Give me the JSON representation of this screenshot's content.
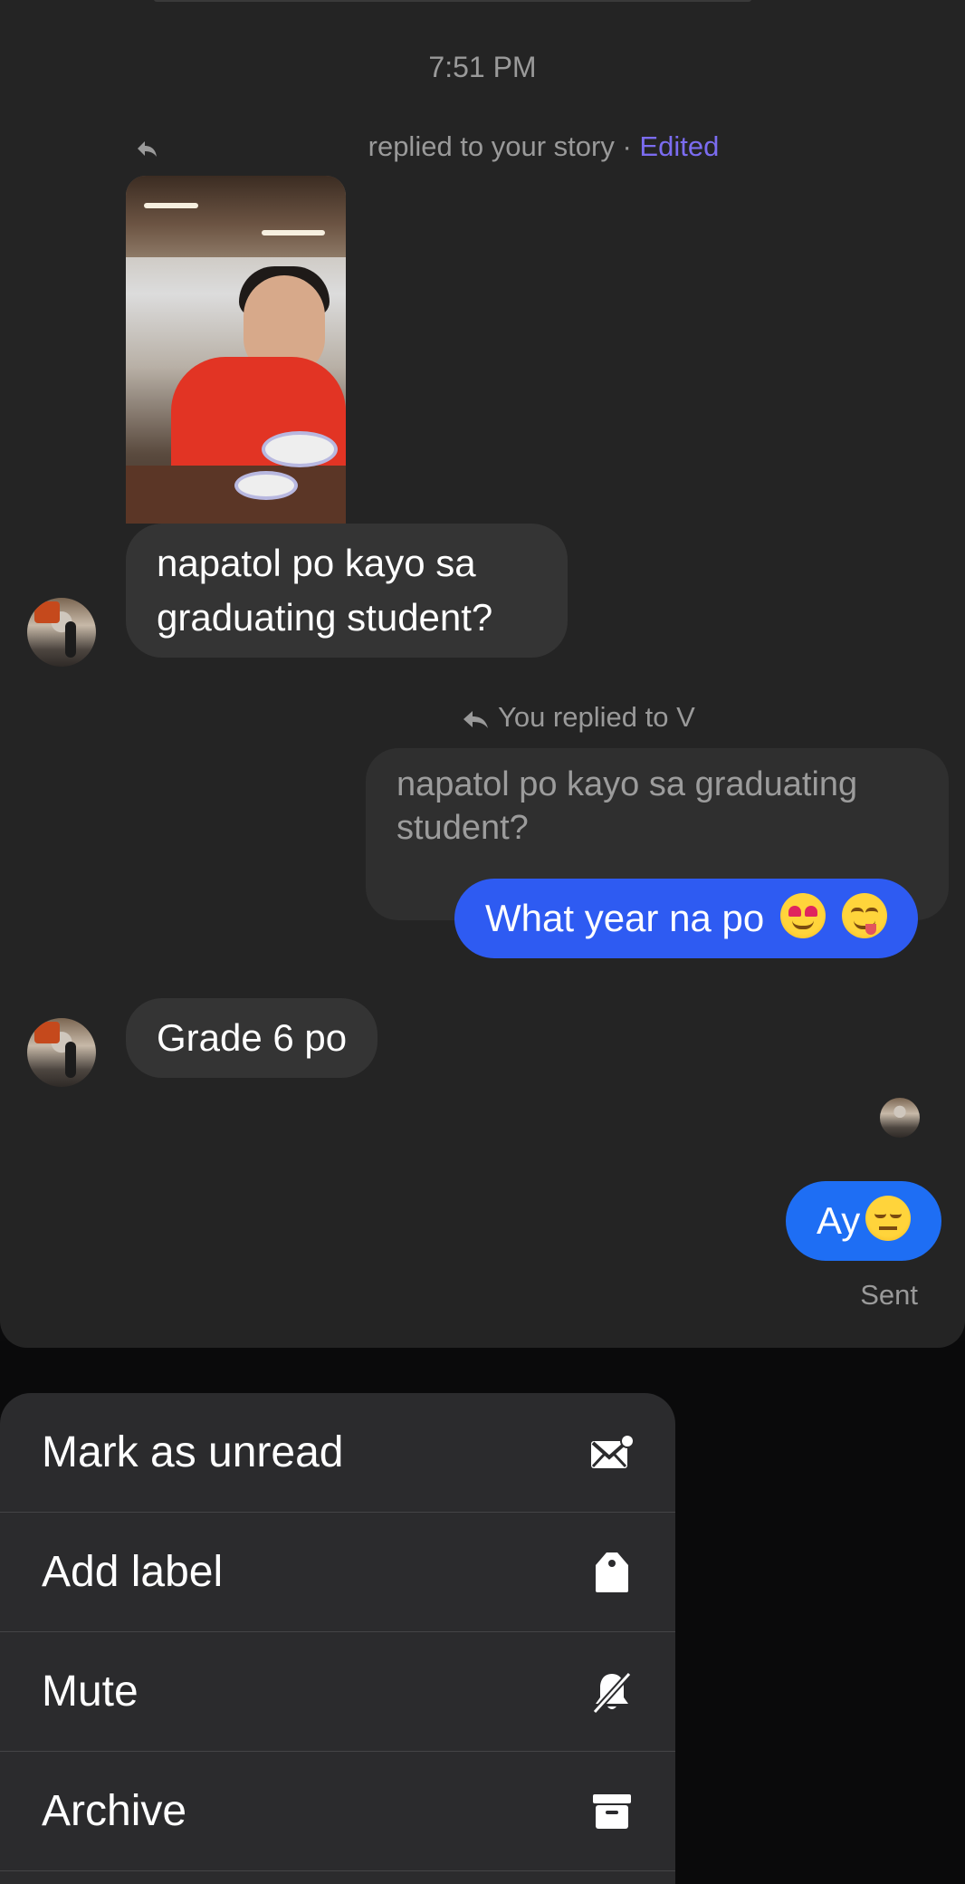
{
  "chat": {
    "timestamp": "7:51 PM",
    "story_reply_note": "replied to your story",
    "edited_label": "Edited",
    "messages": [
      {
        "text": "napatol po kayo sa graduating student?"
      },
      {
        "text": "Grade 6 po"
      }
    ],
    "you_replied_note": "You replied to V",
    "quoted_text": "napatol po kayo sa graduating student?",
    "outgoing": [
      {
        "text": "What year na po",
        "emojis": [
          "heart-eyes-emoji",
          "yum-emoji"
        ]
      },
      {
        "text": "Ay",
        "emojis": [
          "pensive-emoji"
        ]
      }
    ],
    "status": "Sent"
  },
  "menu": {
    "items": [
      {
        "label": "Mark as unread",
        "icon": "envelope-unread-icon"
      },
      {
        "label": "Add label",
        "icon": "tag-icon"
      },
      {
        "label": "Mute",
        "icon": "bell-off-icon"
      },
      {
        "label": "Archive",
        "icon": "archive-icon"
      }
    ]
  },
  "colors": {
    "chat_background": "#242424",
    "incoming_bubble": "#343434",
    "outgoing_bubble": "#1e6ef4",
    "edited_accent": "#7b6cf0",
    "menu_background": "#2b2b2d"
  }
}
